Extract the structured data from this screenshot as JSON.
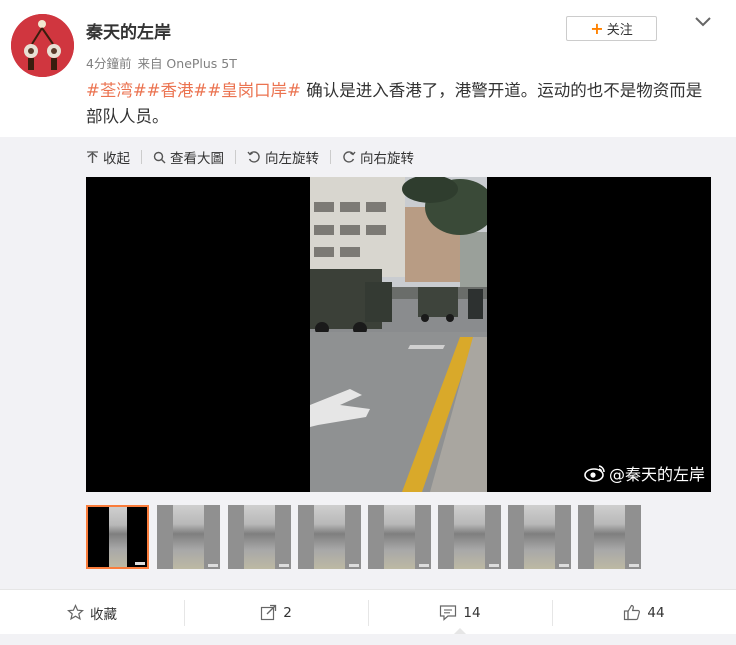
{
  "post": {
    "username": "秦天的左岸",
    "follow_label": "关注",
    "time": "4分鐘前",
    "source": "来自 OnePlus 5T",
    "tags": [
      "#荃湾#",
      "#香港#",
      "#皇岗口岸#"
    ],
    "text": " 确认是进入香港了，港警开道。运动的也不是物资而是部队人员。"
  },
  "media_toolbar": {
    "collapse": "收起",
    "view_large": "查看大圖",
    "rotate_left": "向左旋转",
    "rotate_right": "向右旋转"
  },
  "video": {
    "watermark": "@秦天的左岸"
  },
  "thumbnails": {
    "count": 8,
    "selected_index": 0
  },
  "actions": {
    "favorite": "收藏",
    "repost": "2",
    "comment": "14",
    "like": "44"
  },
  "colors": {
    "accent": "#ff8200",
    "tag": "#eb7350",
    "selected_thumb_border": "#fa7d3c"
  }
}
